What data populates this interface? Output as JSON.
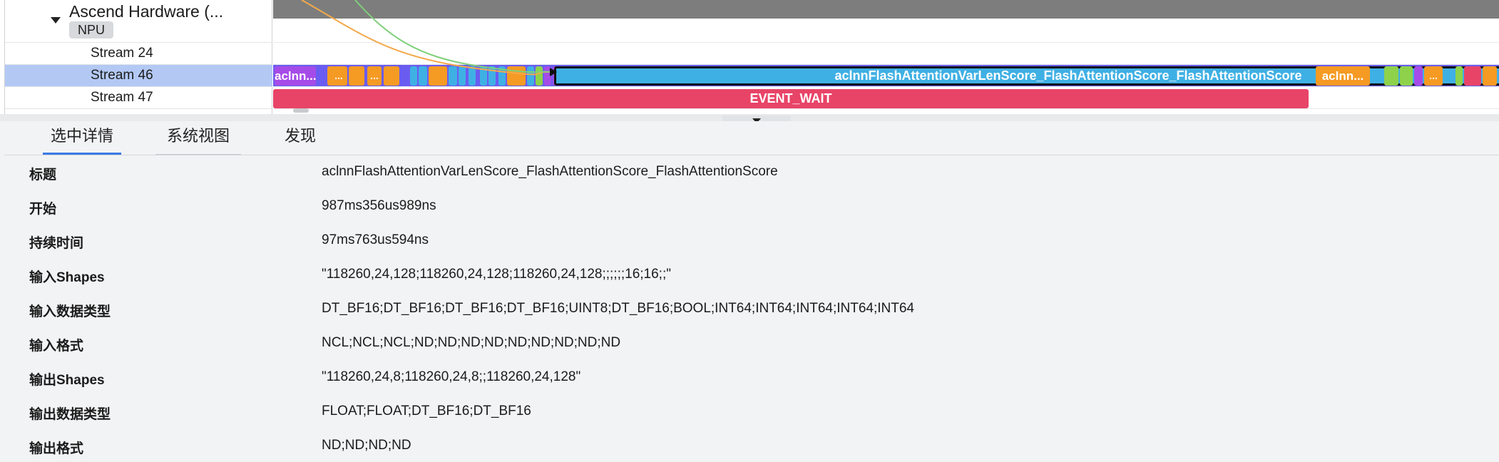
{
  "tree": {
    "group_title": "Ascend Hardware (...",
    "group_badge": "NPU",
    "streams": [
      {
        "label": "Stream 24",
        "selected": false
      },
      {
        "label": "Stream 46",
        "selected": true
      },
      {
        "label": "Stream 47",
        "selected": false
      }
    ]
  },
  "track": {
    "small_slice_1": "aclnn...",
    "small_slice_2": "...",
    "small_slice_3": "...",
    "main_slice": "aclnnFlashAttentionVarLenScore_FlashAttentionScore_FlashAttentionScore",
    "right_slice": "aclnn...",
    "right_slice_dots": "...",
    "event_slice": "EVENT_WAIT",
    "colors": {
      "stream_bg": "#6a5cf0",
      "main_slice": "#3fb0e4",
      "orange": "#f59a23",
      "green": "#8ed14b",
      "purple": "#a54ce8",
      "event": "#e84468",
      "flow_orange": "#f4a94a",
      "flow_green": "#7fcf7a"
    }
  },
  "tabs": [
    {
      "label": "选中详情",
      "active": true
    },
    {
      "label": "系统视图",
      "active": false
    },
    {
      "label": "发现",
      "active": false
    }
  ],
  "details": [
    {
      "key": "标题",
      "value": "aclnnFlashAttentionVarLenScore_FlashAttentionScore_FlashAttentionScore"
    },
    {
      "key": "开始",
      "value": "987ms356us989ns"
    },
    {
      "key": "持续时间",
      "value": "97ms763us594ns"
    },
    {
      "key": "输入Shapes",
      "value": "\"118260,24,128;118260,24,128;118260,24,128;;;;;;16;16;;\""
    },
    {
      "key": "输入数据类型",
      "value": "DT_BF16;DT_BF16;DT_BF16;DT_BF16;UINT8;DT_BF16;BOOL;INT64;INT64;INT64;INT64;INT64"
    },
    {
      "key": "输入格式",
      "value": "NCL;NCL;NCL;ND;ND;ND;ND;ND;ND;ND;ND;ND"
    },
    {
      "key": "输出Shapes",
      "value": "\"118260,24,8;118260,24,8;;118260,24,128\""
    },
    {
      "key": "输出数据类型",
      "value": "FLOAT;FLOAT;DT_BF16;DT_BF16"
    },
    {
      "key": "输出格式",
      "value": "ND;ND;ND;ND"
    }
  ]
}
